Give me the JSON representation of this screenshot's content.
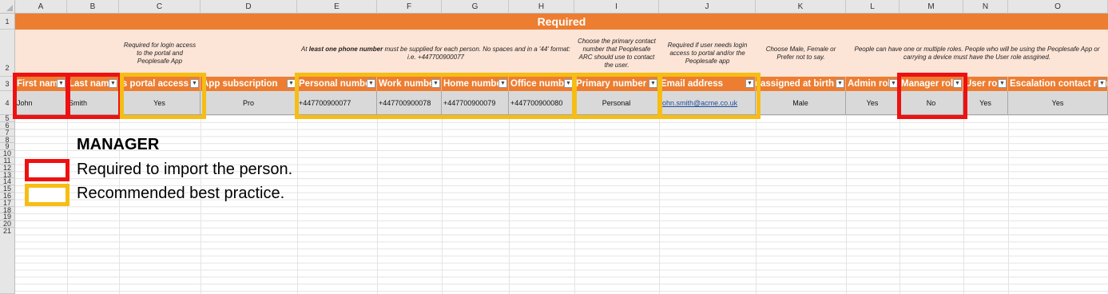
{
  "columns": [
    "A",
    "B",
    "C",
    "D",
    "E",
    "F",
    "G",
    "H",
    "I",
    "J",
    "K",
    "L",
    "M",
    "N",
    "O"
  ],
  "rows": [
    "1",
    "2",
    "3",
    "4",
    "5",
    "6",
    "7",
    "8",
    "9",
    "10",
    "11",
    "12",
    "13",
    "14",
    "15",
    "16",
    "17",
    "18",
    "19",
    "20",
    "21"
  ],
  "band_title": "Required",
  "notes": {
    "c": "Required for login access to the portal and Peoplesafe App",
    "phone_prefix": "At",
    "phone_bold": "least one phone number",
    "phone_rest": "must be supplied for each person. No spaces and in a '44' format: i.e. +447700900077",
    "i": "Choose the primary contact number that Peoplesafe ARC should use to contact the user.",
    "j": "Required if user needs login access to portal and/or the Peoplesafe app",
    "k": "Choose Male, Female or Prefer not to say.",
    "roles": "People can have one or multiple roles.  People who will be using the Peoplesafe App or carrying a device must have the User role assgined."
  },
  "headers": [
    "First name",
    "Last name",
    "Has portal access",
    "App subscription",
    "Personal number",
    "Work number",
    "Home number",
    "Office number",
    "Primary number",
    "Email address",
    "Sex assigned at birth",
    "Admin role",
    "Manager role",
    "User role",
    "Escalation contact role"
  ],
  "record": [
    "John",
    "Smith",
    "Yes",
    "Pro",
    "+447700900077",
    "+447700900078",
    "+447700900079",
    "+447700900080",
    "Personal",
    "john.smith@acme.co.uk",
    "Male",
    "Yes",
    "No",
    "Yes",
    "Yes"
  ],
  "legend": {
    "title": "MANAGER",
    "required": "Required to import the person.",
    "recommended": "Recommended best practice."
  },
  "colors": {
    "orange": "#ed7d31",
    "peach": "#fce4d6",
    "red_outline": "#ee1111",
    "amber_outline": "#f6bd14"
  },
  "icons": {
    "filter": "dropdown-arrow-icon"
  }
}
